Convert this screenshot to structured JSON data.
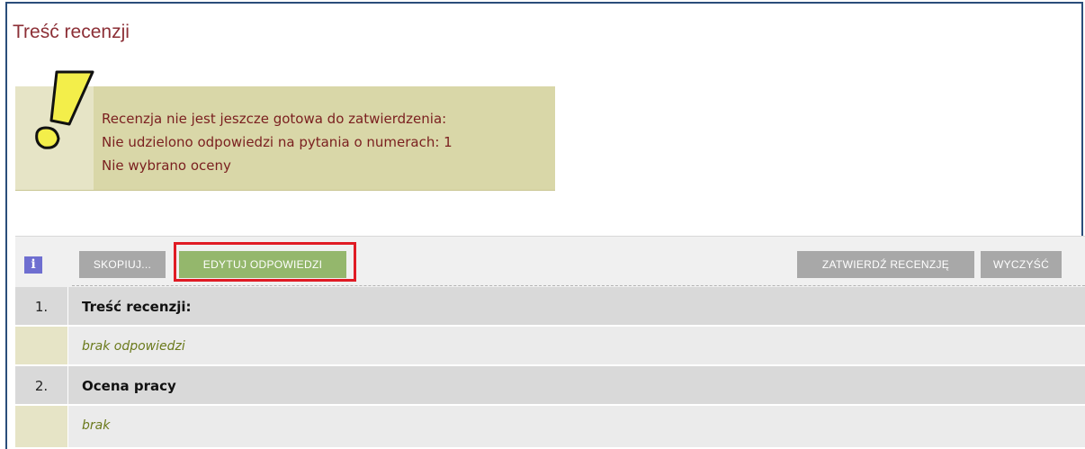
{
  "page": {
    "title": "Treść recenzji"
  },
  "warning": {
    "icon": "exclamation-warning-icon",
    "lines": [
      "Recenzja nie jest jeszcze gotowa do zatwierdzenia:",
      "Nie udzielono odpowiedzi na pytania o numerach: 1",
      "Nie wybrano oceny"
    ]
  },
  "toolbar": {
    "info_label": "i",
    "copy_label": "SKOPIUJ...",
    "edit_label": "EDYTUJ ODPOWIEDZI",
    "approve_label": "ZATWIERDŹ RECENZJĘ",
    "clear_label": "WYCZYŚĆ"
  },
  "questions": [
    {
      "number": "1.",
      "title": "Treść recenzji:",
      "answer": "brak odpowiedzi"
    },
    {
      "number": "2.",
      "title": "Ocena pracy",
      "answer": "brak"
    }
  ],
  "colors": {
    "title": "#8c2f36",
    "warning_bg": "#d9d7a8",
    "warning_text": "#7a1f1f",
    "edit_button": "#94b76c",
    "grey_button": "#a8a8a8",
    "highlight": "#e01b24",
    "answer_text": "#6b7a1c"
  }
}
